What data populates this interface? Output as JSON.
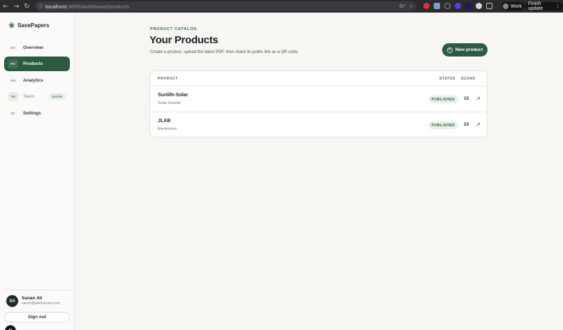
{
  "browser": {
    "url_host": "localhost",
    "url_path": ":3005/dashboard/products",
    "work_label": "Work",
    "update_label": "Finish update",
    "icons": [
      "back-icon",
      "forward-icon",
      "reload-icon",
      "site-info-icon",
      "translate-icon",
      "bookmark-star-icon",
      "extensions-icon",
      "kebab-menu-icon"
    ]
  },
  "sidebar": {
    "brand": "SavePapers",
    "items": [
      {
        "abbr": "OV",
        "label": "Overview"
      },
      {
        "abbr": "PD",
        "label": "Products"
      },
      {
        "abbr": "AN",
        "label": "Analytics"
      },
      {
        "abbr": "TM",
        "label": "Team",
        "badge": "SOON"
      },
      {
        "abbr": "ST",
        "label": "Settings"
      }
    ],
    "active_item": "Products",
    "user": {
      "initials": "SA",
      "name": "Sanan Ali",
      "email": "sanan@askhumans.com"
    },
    "signout_label": "Sign out",
    "dev_badge": "N"
  },
  "main": {
    "eyebrow": "PRODUCT CATALOG",
    "title": "Your Products",
    "subtitle": "Create a product, upload the latest PDF, then share its public link as a QR code.",
    "new_button": "New product",
    "table": {
      "headers": {
        "product": "PRODUCT",
        "status": "STATUS",
        "scans": "SCANS"
      },
      "rows": [
        {
          "name": "Sunlife-Solar",
          "category": "Solar Inverter",
          "status": "PUBLISHED",
          "scans": "15"
        },
        {
          "name": "JLAB",
          "category": "Electronics",
          "status": "PUBLISHED",
          "scans": "23"
        }
      ]
    }
  },
  "colors": {
    "accent": "#2d5a41",
    "background": "#f7f6f3",
    "status_bg": "#e7f1ea"
  }
}
